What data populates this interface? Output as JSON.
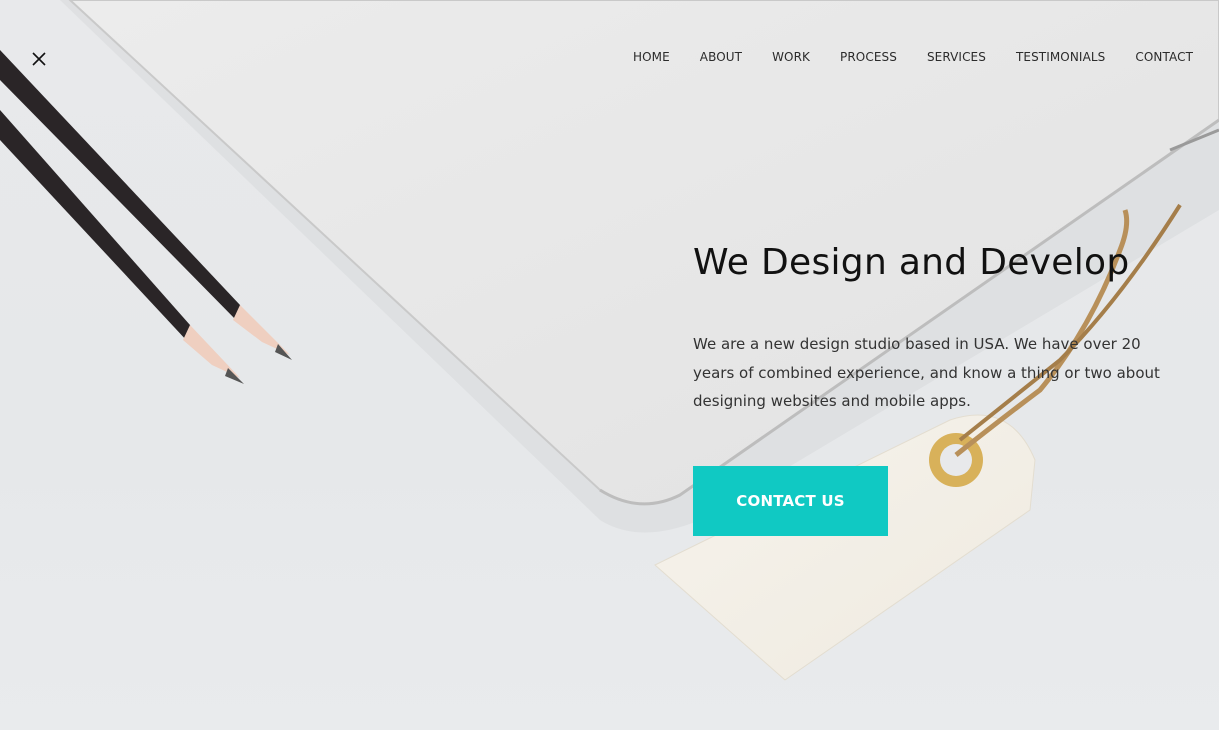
{
  "nav": {
    "close_icon": "close-icon",
    "items": [
      {
        "label": "HOME"
      },
      {
        "label": "ABOUT"
      },
      {
        "label": "WORK"
      },
      {
        "label": "PROCESS"
      },
      {
        "label": "SERVICES"
      },
      {
        "label": "TESTIMONIALS"
      },
      {
        "label": "CONTACT"
      }
    ]
  },
  "hero": {
    "headline": "We Design and Develop",
    "lead": "We are a new design studio based in USA. We have over 20 years of combined experience, and know a thing or two about designing websites and mobile apps.",
    "cta_label": "CONTACT US"
  },
  "colors": {
    "accent": "#10c9c3",
    "text": "#111111",
    "background": "#e9eaec"
  }
}
